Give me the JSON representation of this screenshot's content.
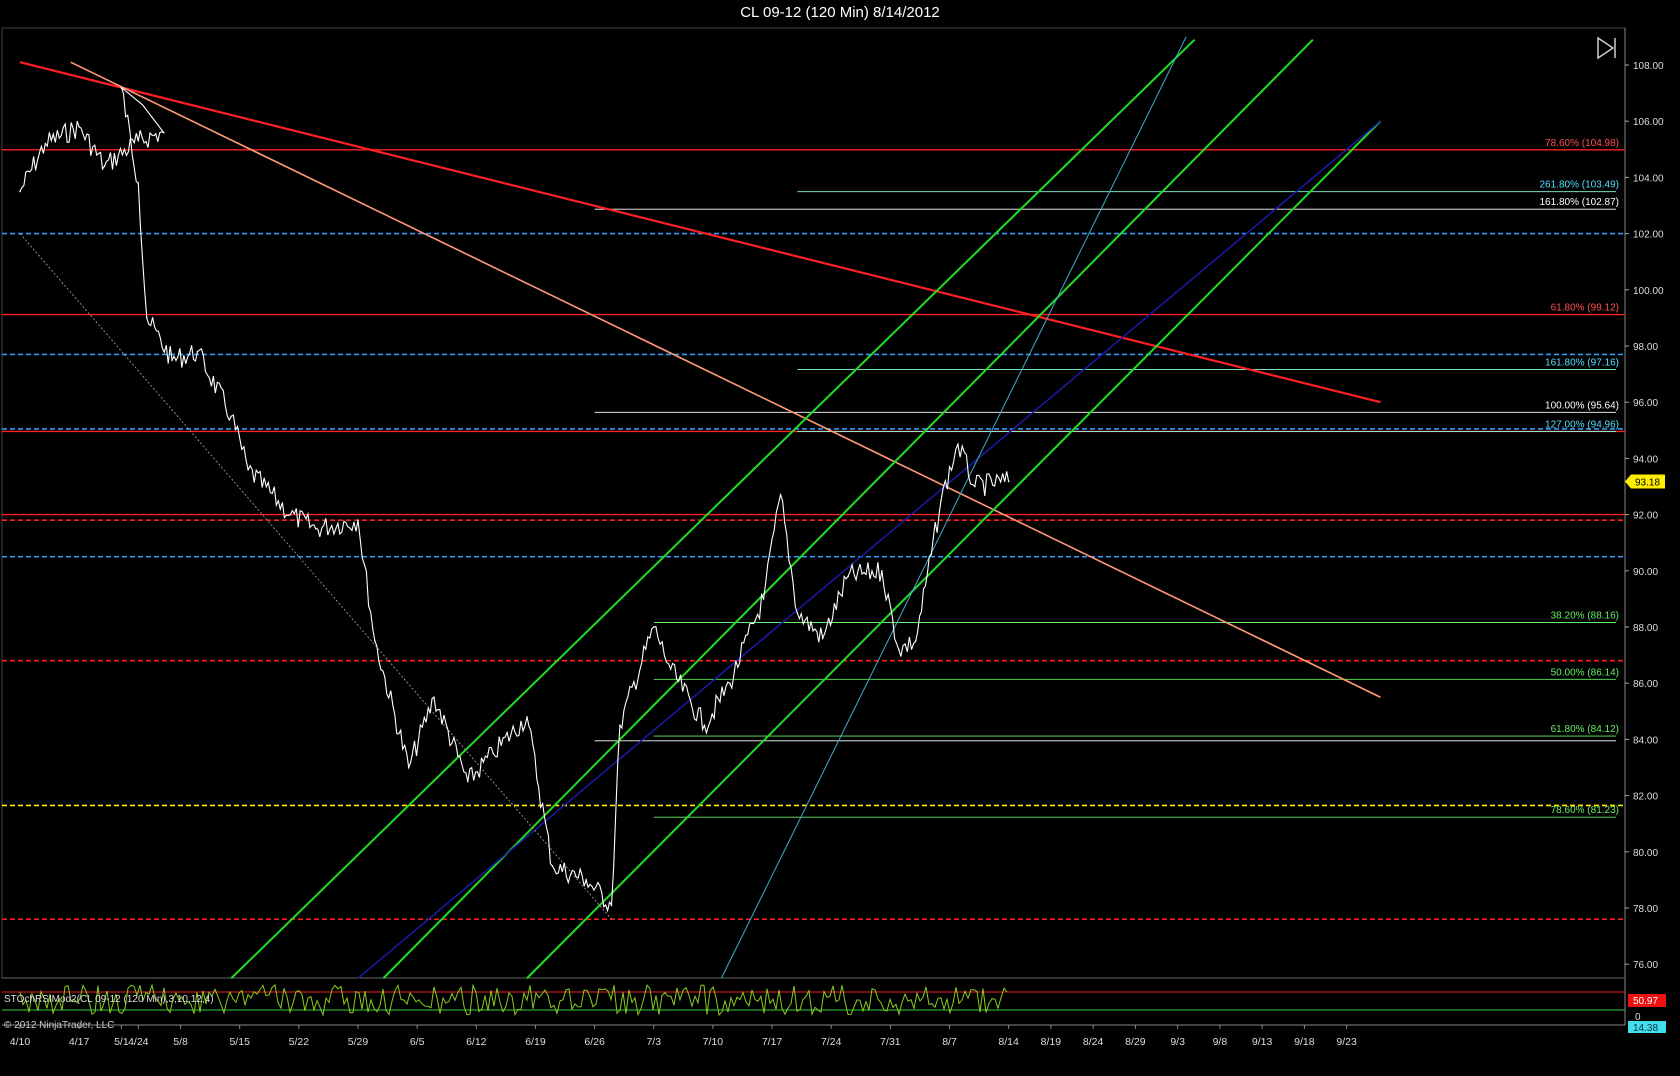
{
  "title": "CL 09-12 (120 Min)  8/14/2012",
  "copyright": "© 2012 NinjaTrader, LLC",
  "nav_icon": "skip-to-end-icon",
  "colors": {
    "background": "#000000",
    "price": "#ffffff",
    "channel": "#22dd22",
    "resistance": "#ff2020",
    "downtrend": "#ff9977",
    "dashed_blue": "#3399ff",
    "dashed_red": "#ff2020",
    "dashed_yellow": "#ffee00",
    "regression": "#1a1aaa",
    "steep_line": "#44aacc",
    "oscillator": "#88cc22",
    "last_price_bg": "#ffee00",
    "osc_red_bg": "#ee1111",
    "osc_cyan_bg": "#44ddee"
  },
  "chart_data": {
    "type": "line",
    "title": "CL 09-12 (120 Min)  8/14/2012",
    "xlabel": "",
    "ylabel": "",
    "ylim": [
      75.2,
      109.0
    ],
    "y_ticks": [
      "108.00",
      "106.00",
      "104.00",
      "102.00",
      "100.00",
      "98.00",
      "96.00",
      "94.00",
      "92.00",
      "90.00",
      "88.00",
      "86.00",
      "84.00",
      "82.00",
      "80.00",
      "78.00",
      "76.00"
    ],
    "x_tick_labels": [
      "4/10",
      "4/17",
      "4/24",
      "5/1",
      "5/8",
      "5/15",
      "5/22",
      "5/29",
      "6/5",
      "6/12",
      "6/19",
      "6/26",
      "7/3",
      "7/10",
      "7/17",
      "7/24",
      "7/31",
      "8/7",
      "8/14",
      "8/19",
      "8/24",
      "8/29",
      "9/3",
      "9/8",
      "9/13",
      "9/18",
      "9/23"
    ],
    "last_price": "93.18",
    "price_series": {
      "name": "",
      "x": [
        "4/10",
        "4/13",
        "4/17",
        "4/20",
        "4/24",
        "4/27",
        "5/1",
        "5/3",
        "5/4",
        "5/7",
        "5/10",
        "5/14",
        "5/16",
        "5/21",
        "5/24",
        "5/29",
        "5/31",
        "6/4",
        "6/7",
        "6/11",
        "6/14",
        "6/18",
        "6/21",
        "6/25",
        "6/28",
        "6/29",
        "7/3",
        "7/5",
        "7/9",
        "7/12",
        "7/16",
        "7/18",
        "7/20",
        "7/23",
        "7/26",
        "7/30",
        "8/1",
        "8/3",
        "8/6",
        "8/8",
        "8/10",
        "8/14"
      ],
      "y": [
        103.5,
        105.2,
        105.8,
        104.4,
        105.3,
        105.6,
        107.2,
        103.8,
        99.0,
        97.5,
        97.8,
        95.5,
        93.6,
        92.0,
        91.5,
        91.8,
        87.5,
        83.0,
        85.5,
        82.5,
        83.5,
        84.8,
        79.5,
        79.0,
        78.1,
        84.5,
        88.0,
        86.5,
        84.5,
        86.0,
        89.0,
        92.7,
        88.5,
        87.6,
        89.8,
        90.0,
        87.2,
        87.5,
        92.5,
        94.5,
        93.0,
        93.18
      ]
    },
    "horizontal_lines": [
      {
        "style": "solid",
        "color": "#ff2020",
        "y": 104.98,
        "label": "78.60% (104.98)",
        "label_color": "#ff5050"
      },
      {
        "style": "solid",
        "color": "#ff2020",
        "y": 99.12,
        "label": "61.80% (99.12)",
        "label_color": "#ff5050"
      },
      {
        "style": "solid",
        "color": "#ff2020",
        "y": 94.96,
        "label": "",
        "label_color": ""
      },
      {
        "style": "solid",
        "color": "#ff2020",
        "y": 92.0,
        "label": "",
        "label_color": ""
      },
      {
        "style": "dashed",
        "color": "#3399ff",
        "y": 102.0
      },
      {
        "style": "dashed",
        "color": "#3399ff",
        "y": 97.7
      },
      {
        "style": "dashed",
        "color": "#3399ff",
        "y": 95.05
      },
      {
        "style": "dashed",
        "color": "#3399ff",
        "y": 90.5
      },
      {
        "style": "dashed",
        "color": "#ff2020",
        "y": 91.8
      },
      {
        "style": "dashed",
        "color": "#ff2020",
        "y": 86.8
      },
      {
        "style": "dashed",
        "color": "#ff2020",
        "y": 77.6
      },
      {
        "style": "dashed",
        "color": "#ffee00",
        "y": 81.65
      }
    ],
    "fib_levels": [
      {
        "label": "261.80% (103.49)",
        "y": 103.49,
        "from": "7/20",
        "color": "#88ffdd",
        "label_color": "#55ddff"
      },
      {
        "label": "161.80% (102.87)",
        "y": 102.87,
        "from": "6/26",
        "color": "#ffffff",
        "label_color": "#ffffff"
      },
      {
        "label": "161.80% (97.16)",
        "y": 97.16,
        "from": "7/20",
        "color": "#88ffdd",
        "label_color": "#55ddff"
      },
      {
        "label": "100.00% (95.64)",
        "y": 95.64,
        "from": "6/26",
        "color": "#ffffff",
        "label_color": "#ffffff"
      },
      {
        "label": "127.00% (94.96)",
        "y": 94.96,
        "from": "7/20",
        "color": "#88ffdd",
        "label_color": "#55ddff"
      },
      {
        "label": "38.20% (88.16)",
        "y": 88.16,
        "from": "7/3",
        "color": "#66ee66",
        "label_color": "#66ee66"
      },
      {
        "label": "50.00% (86.14)",
        "y": 86.14,
        "from": "7/3",
        "color": "#66ee66",
        "label_color": "#66ee66"
      },
      {
        "label": "61.80% (84.12)",
        "y": 84.12,
        "from": "7/3",
        "color": "#66ee66",
        "label_color": "#66ee66"
      },
      {
        "label": "",
        "y": 83.95,
        "from": "6/26",
        "color": "#ffffff",
        "label_color": "#ffffff"
      },
      {
        "label": "78.60% (81.23)",
        "y": 81.23,
        "from": "7/3",
        "color": "#66ee66",
        "label_color": "#66ee66"
      }
    ],
    "trend_lines": [
      {
        "name": "",
        "color": "#ff2020",
        "width": 2.2,
        "from": [
          "4/10",
          108.1
        ],
        "to": [
          "9/27",
          96.0
        ]
      },
      {
        "name": "",
        "color": "#ff9977",
        "width": 1.6,
        "from": [
          "4/16",
          108.1
        ],
        "to": [
          "9/27",
          85.5
        ]
      },
      {
        "name": "",
        "color": "#22dd22",
        "width": 2,
        "from": [
          "5/14",
          75.5
        ],
        "to": [
          "9/5",
          108.9
        ]
      },
      {
        "name": "",
        "color": "#22dd22",
        "width": 2,
        "from": [
          "6/1",
          75.5
        ],
        "to": [
          "9/19",
          108.9
        ]
      },
      {
        "name": "",
        "color": "#22dd22",
        "width": 2,
        "from": [
          "6/18",
          75.5
        ],
        "to": [
          "9/27",
          106.0
        ]
      },
      {
        "name": "",
        "color": "#1a1aaa",
        "width": 1.5,
        "from": [
          "5/29",
          75.5
        ],
        "to": [
          "9/27",
          106.0
        ]
      },
      {
        "name": "",
        "color": "#44aacc",
        "width": 1,
        "from": [
          "7/11",
          75.5
        ],
        "to": [
          "9/4",
          109.0
        ]
      },
      {
        "name": "",
        "color": "#aaaaaa",
        "width": 0.8,
        "dash": "2,2",
        "from": [
          "4/10",
          102.0
        ],
        "to": [
          "6/28",
          77.6
        ]
      }
    ],
    "oscillator": {
      "label": "STOchRSIMod2(CL 09-12 (120 Min),3,10,12,4)",
      "value_red": "50.97",
      "value_zero": "0",
      "value_cyan": "14.38"
    }
  }
}
